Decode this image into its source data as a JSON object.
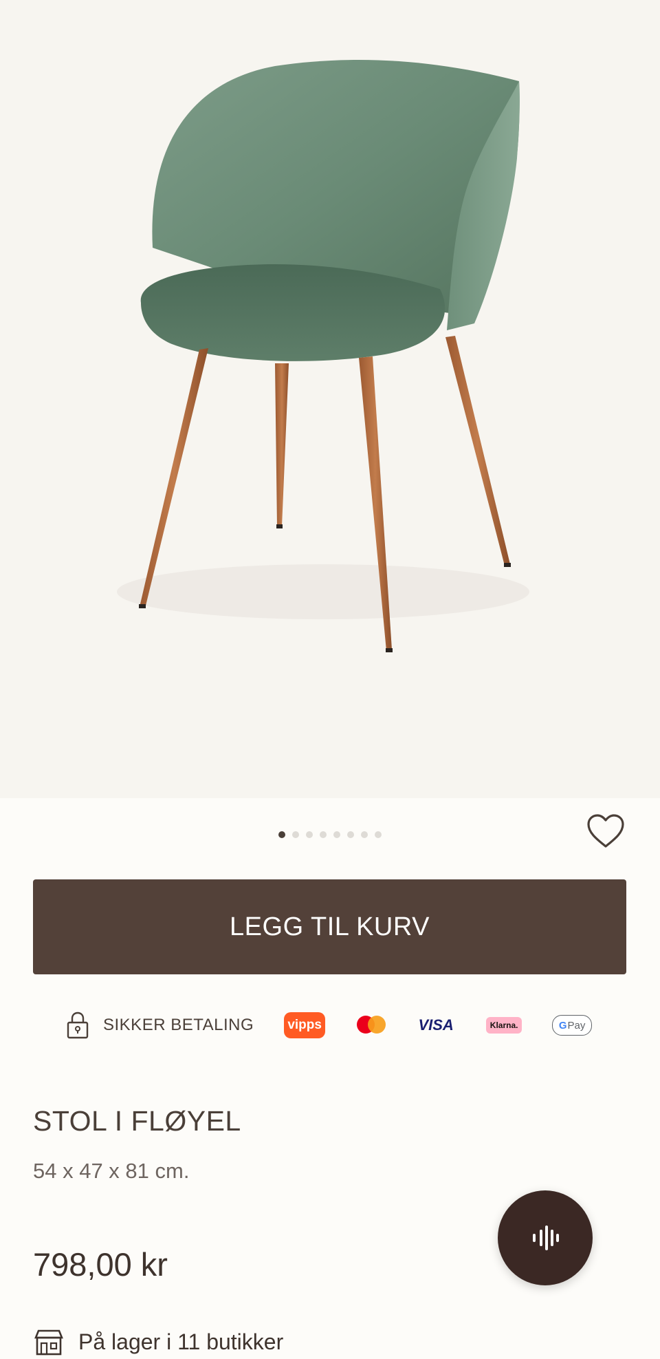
{
  "product": {
    "image_alt": "green velvet dining chair with wooden legs",
    "gallery": {
      "total": 8,
      "active_index": 0
    },
    "title": "STOL I FLØYEL",
    "dimensions": "54 x 47 x 81 cm.",
    "price": "798,00 kr"
  },
  "actions": {
    "add_to_cart_label": "LEGG TIL KURV",
    "wishlist_icon": "heart-outline-icon",
    "voice_icon": "soundwave-icon"
  },
  "payment": {
    "secure_label": "SIKKER BETALING",
    "methods": {
      "vipps": "vipps",
      "mastercard": "",
      "visa": "VISA",
      "klarna": "Klarna.",
      "gpay": "Pay"
    }
  },
  "stock": {
    "text": "På lager i 11 butikker"
  },
  "colors": {
    "accent": "#534139",
    "voice_button": "#3b2824",
    "background": "#fdfcf9",
    "image_background": "#f7f5f0"
  }
}
